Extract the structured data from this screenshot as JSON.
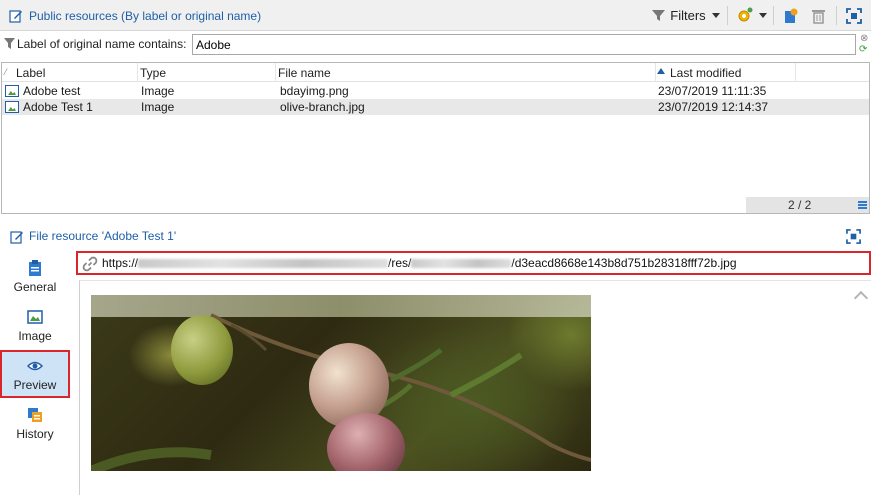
{
  "header": {
    "title": "Public resources (By label or original name)",
    "filters_label": "Filters"
  },
  "filter": {
    "label": "Label of original name contains:",
    "value": "Adobe"
  },
  "table": {
    "columns": [
      "Label",
      "Type",
      "File name",
      "Last modified"
    ],
    "sort_column": "Last modified",
    "rows": [
      {
        "label": "Adobe test",
        "type": "Image",
        "file_name": "bdayimg.png",
        "last_modified": "23/07/2019 11:11:35"
      },
      {
        "label": "Adobe  Test 1",
        "type": "Image",
        "file_name": "olive-branch.jpg",
        "last_modified": "23/07/2019 12:14:37"
      }
    ],
    "count": "2 / 2"
  },
  "detail": {
    "title": "File resource 'Adobe  Test 1'",
    "nav": [
      {
        "label": "General",
        "icon": "clipboard-icon"
      },
      {
        "label": "Image",
        "icon": "image-icon"
      },
      {
        "label": "Preview",
        "icon": "eye-icon"
      },
      {
        "label": "History",
        "icon": "history-icon"
      }
    ],
    "active_tab": "Preview",
    "url_prefix": "https://",
    "url_mid": "/res/",
    "url_suffix": "/d3eacd8668e143b8d751b28318fff72b.jpg"
  },
  "colors": {
    "accent": "#1f5fa8",
    "highlight_border": "#d9262a",
    "active_tab_bg": "#cfe3f6"
  }
}
